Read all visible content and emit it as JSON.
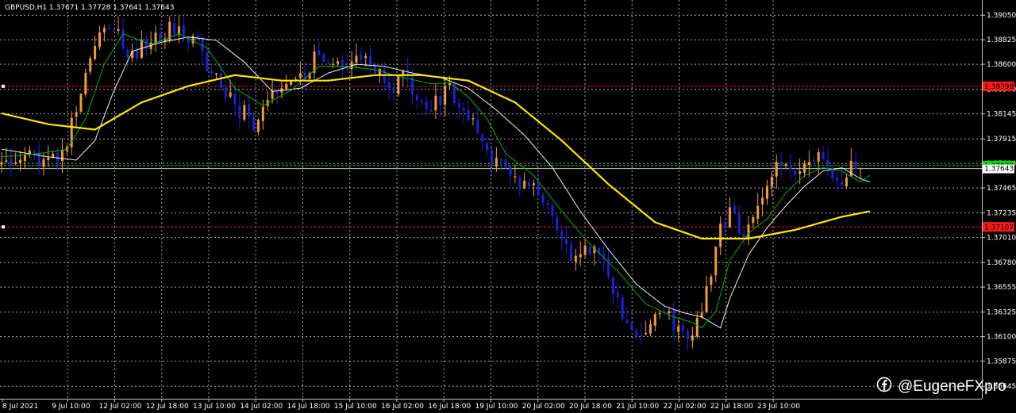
{
  "header": {
    "symbol": "GBPUSD,H1",
    "ohlc": "1.37671 1.37728 1.37641 1.37643"
  },
  "watermark": "@EugeneFXpro",
  "colors": {
    "background": "#000000",
    "grid": "#c8c8c8",
    "bull_candle": "#f29a3c",
    "bear_candle": "#1a22d8",
    "ma_slow": "#ffe600",
    "ma_mid": "#00b400",
    "ma_fast": "#f0f0f0",
    "level_red": "#ff1a1a",
    "level_green": "#00e000"
  },
  "chart_data": {
    "type": "candlestick",
    "symbol": "GBPUSD",
    "timeframe": "H1",
    "ylim": [
      1.3553,
      1.3919
    ],
    "y_ticks": [
      "1.39050",
      "1.38825",
      "1.38600",
      "1.38370",
      "1.38145",
      "1.37915",
      "1.37690",
      "1.37465",
      "1.37235",
      "1.37010",
      "1.36780",
      "1.36555",
      "1.36325",
      "1.36100",
      "1.35875",
      "1.35645"
    ],
    "x_labels": [
      "8 Jul 2021",
      "9 Jul 10:00",
      "12 Jul 02:00",
      "12 Jul 18:00",
      "13 Jul 10:00",
      "14 Jul 02:00",
      "14 Jul 18:00",
      "15 Jul 10:00",
      "16 Jul 02:00",
      "16 Jul 18:00",
      "19 Jul 10:00",
      "20 Jul 02:00",
      "20 Jul 18:00",
      "21 Jul 10:00",
      "22 Jul 02:00",
      "22 Jul 18:00",
      "23 Jul 10:00"
    ],
    "levels": [
      {
        "value": 1.38398,
        "label": "1.38398",
        "color": "red"
      },
      {
        "value": 1.3767,
        "label": "1.37670",
        "color": "green"
      },
      {
        "value": 1.37107,
        "label": "1.37107",
        "color": "red"
      }
    ],
    "current_price": {
      "value": 1.37643,
      "label": "1.37643"
    },
    "price_path": [
      [
        0,
        1.3768
      ],
      [
        5,
        1.3782
      ],
      [
        10,
        1.377
      ],
      [
        14,
        1.3786
      ],
      [
        18,
        1.3855
      ],
      [
        20,
        1.388
      ],
      [
        22,
        1.3902
      ],
      [
        25,
        1.3888
      ],
      [
        28,
        1.3865
      ],
      [
        32,
        1.3885
      ],
      [
        34,
        1.389
      ],
      [
        38,
        1.3895
      ],
      [
        42,
        1.3878
      ],
      [
        46,
        1.3845
      ],
      [
        50,
        1.3822
      ],
      [
        54,
        1.3808
      ],
      [
        58,
        1.383
      ],
      [
        62,
        1.3843
      ],
      [
        65,
        1.3845
      ],
      [
        68,
        1.3875
      ],
      [
        71,
        1.3862
      ],
      [
        74,
        1.385
      ],
      [
        77,
        1.3865
      ],
      [
        80,
        1.3855
      ],
      [
        83,
        1.384
      ],
      [
        86,
        1.3848
      ],
      [
        89,
        1.383
      ],
      [
        92,
        1.3823
      ],
      [
        96,
        1.3836
      ],
      [
        99,
        1.382
      ],
      [
        102,
        1.3795
      ],
      [
        106,
        1.3768
      ],
      [
        110,
        1.3757
      ],
      [
        114,
        1.3745
      ],
      [
        118,
        1.372
      ],
      [
        121,
        1.369
      ],
      [
        124,
        1.3685
      ],
      [
        127,
        1.3688
      ],
      [
        130,
        1.367
      ],
      [
        133,
        1.3635
      ],
      [
        136,
        1.3608
      ],
      [
        139,
        1.3625
      ],
      [
        142,
        1.3632
      ],
      [
        145,
        1.3618
      ],
      [
        148,
        1.3612
      ],
      [
        150,
        1.363
      ],
      [
        152,
        1.367
      ],
      [
        154,
        1.371
      ],
      [
        156,
        1.372
      ],
      [
        158,
        1.371
      ],
      [
        160,
        1.3708
      ],
      [
        162,
        1.3722
      ],
      [
        164,
        1.3745
      ],
      [
        166,
        1.3768
      ],
      [
        169,
        1.376
      ],
      [
        172,
        1.377
      ],
      [
        175,
        1.3778
      ],
      [
        178,
        1.3762
      ],
      [
        180,
        1.3745
      ],
      [
        182,
        1.3772
      ],
      [
        183,
        1.3767
      ],
      [
        184,
        1.37643
      ]
    ],
    "ma_slow_path": [
      [
        0,
        1.3815
      ],
      [
        10,
        1.3805
      ],
      [
        20,
        1.38
      ],
      [
        30,
        1.3825
      ],
      [
        40,
        1.384
      ],
      [
        50,
        1.385
      ],
      [
        60,
        1.3845
      ],
      [
        70,
        1.3845
      ],
      [
        80,
        1.385
      ],
      [
        90,
        1.385
      ],
      [
        100,
        1.3845
      ],
      [
        110,
        1.3825
      ],
      [
        120,
        1.379
      ],
      [
        130,
        1.375
      ],
      [
        140,
        1.3715
      ],
      [
        150,
        1.37
      ],
      [
        160,
        1.37
      ],
      [
        170,
        1.3708
      ],
      [
        180,
        1.372
      ],
      [
        186,
        1.3725
      ]
    ],
    "ma_mid_path": [
      [
        0,
        1.3775
      ],
      [
        8,
        1.3778
      ],
      [
        14,
        1.3782
      ],
      [
        18,
        1.381
      ],
      [
        22,
        1.386
      ],
      [
        26,
        1.3888
      ],
      [
        32,
        1.3878
      ],
      [
        38,
        1.3888
      ],
      [
        44,
        1.3875
      ],
      [
        50,
        1.3838
      ],
      [
        56,
        1.3822
      ],
      [
        62,
        1.3836
      ],
      [
        68,
        1.3858
      ],
      [
        74,
        1.3858
      ],
      [
        80,
        1.3855
      ],
      [
        86,
        1.3848
      ],
      [
        92,
        1.3842
      ],
      [
        96,
        1.3843
      ],
      [
        100,
        1.383
      ],
      [
        104,
        1.381
      ],
      [
        108,
        1.3778
      ],
      [
        114,
        1.3758
      ],
      [
        120,
        1.3725
      ],
      [
        126,
        1.3695
      ],
      [
        132,
        1.367
      ],
      [
        138,
        1.364
      ],
      [
        144,
        1.3628
      ],
      [
        148,
        1.3623
      ],
      [
        150,
        1.3618
      ],
      [
        153,
        1.3633
      ],
      [
        156,
        1.368
      ],
      [
        160,
        1.3705
      ],
      [
        164,
        1.3718
      ],
      [
        168,
        1.3742
      ],
      [
        172,
        1.3758
      ],
      [
        176,
        1.3765
      ],
      [
        180,
        1.3762
      ],
      [
        184,
        1.3752
      ],
      [
        186,
        1.3758
      ]
    ],
    "ma_fast_path": [
      [
        0,
        1.3782
      ],
      [
        10,
        1.3775
      ],
      [
        16,
        1.3772
      ],
      [
        20,
        1.379
      ],
      [
        24,
        1.3835
      ],
      [
        28,
        1.3872
      ],
      [
        34,
        1.388
      ],
      [
        40,
        1.3885
      ],
      [
        46,
        1.3882
      ],
      [
        52,
        1.3862
      ],
      [
        58,
        1.3835
      ],
      [
        64,
        1.3838
      ],
      [
        70,
        1.3852
      ],
      [
        76,
        1.386
      ],
      [
        82,
        1.3858
      ],
      [
        88,
        1.3852
      ],
      [
        94,
        1.3848
      ],
      [
        100,
        1.3838
      ],
      [
        106,
        1.3818
      ],
      [
        112,
        1.3795
      ],
      [
        118,
        1.3765
      ],
      [
        124,
        1.3725
      ],
      [
        130,
        1.369
      ],
      [
        136,
        1.3658
      ],
      [
        142,
        1.3638
      ],
      [
        146,
        1.3632
      ],
      [
        150,
        1.3628
      ],
      [
        154,
        1.3618
      ],
      [
        156,
        1.3645
      ],
      [
        160,
        1.3685
      ],
      [
        164,
        1.371
      ],
      [
        168,
        1.373
      ],
      [
        172,
        1.3748
      ],
      [
        176,
        1.3762
      ],
      [
        180,
        1.3765
      ],
      [
        184,
        1.3755
      ],
      [
        186,
        1.3752
      ]
    ],
    "x_domain": [
      0,
      210
    ]
  }
}
